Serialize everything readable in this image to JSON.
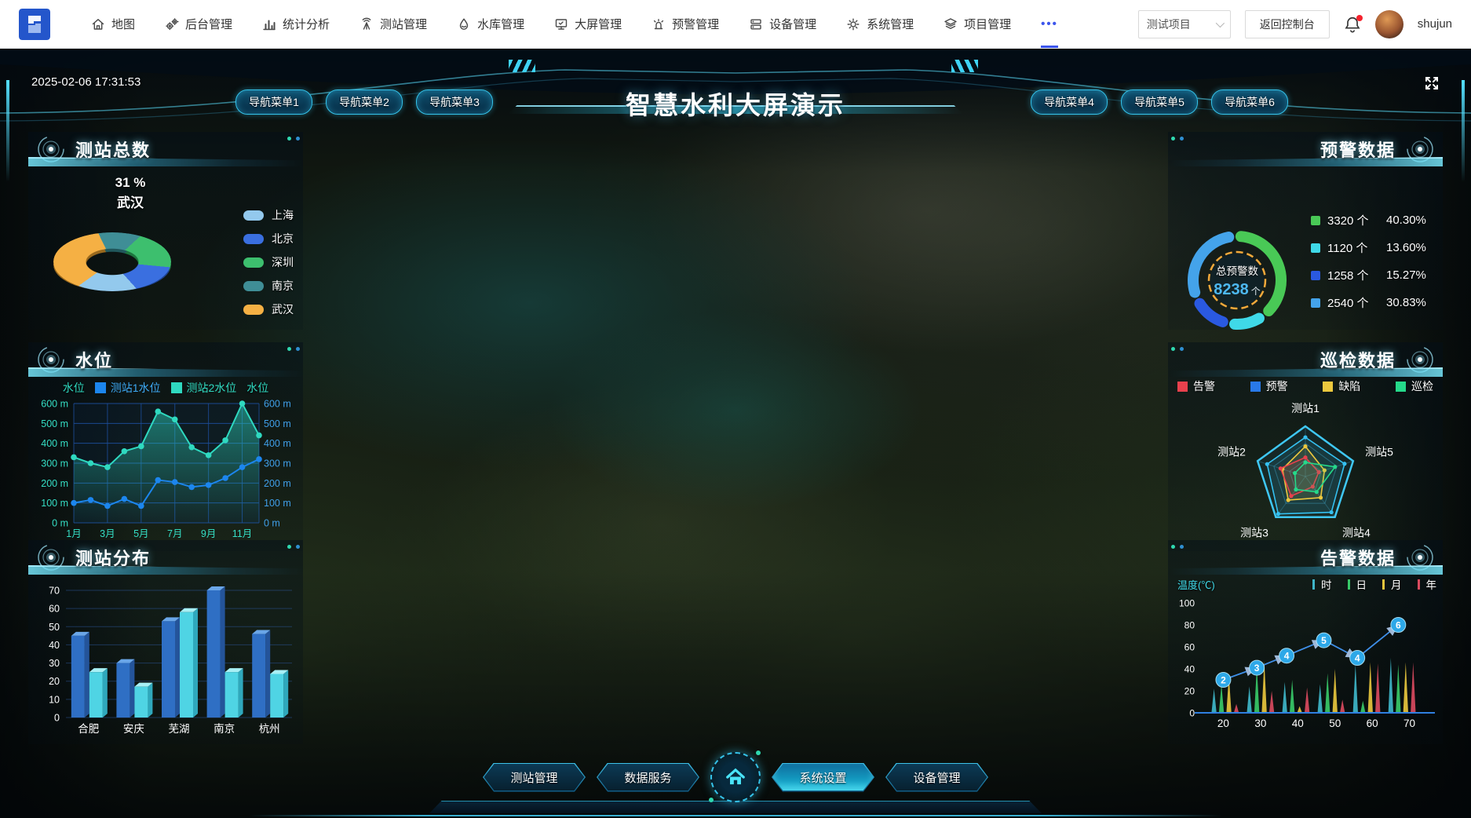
{
  "topnav": {
    "menu": [
      {
        "label": "地图"
      },
      {
        "label": "后台管理"
      },
      {
        "label": "统计分析"
      },
      {
        "label": "测站管理"
      },
      {
        "label": "水库管理"
      },
      {
        "label": "大屏管理"
      },
      {
        "label": "预警管理"
      },
      {
        "label": "设备管理"
      },
      {
        "label": "系统管理"
      },
      {
        "label": "项目管理"
      },
      {
        "label": "•••"
      }
    ],
    "project_select": "测试项目",
    "back_button": "返回控制台",
    "username": "shujun"
  },
  "screen": {
    "timestamp": "2025-02-06 17:31:53",
    "title": "智慧水利大屏演示",
    "nav_buttons_left": [
      "导航菜单1",
      "导航菜单2",
      "导航菜单3"
    ],
    "nav_buttons_right": [
      "导航菜单4",
      "导航菜单5",
      "导航菜单6"
    ],
    "bottom_nav": [
      "测站管理",
      "数据服务",
      "系统设置",
      "设备管理"
    ]
  },
  "panels": {
    "station_total_title": "测站总数",
    "water_level_title": "水位",
    "station_dist_title": "测站分布",
    "warning_title": "预警数据",
    "inspection_title": "巡检数据",
    "alarm_title": "告警数据"
  },
  "chart_data": [
    {
      "id": "station_pie",
      "type": "pie",
      "selected_label": "31 %",
      "selected_name": "武汉",
      "series": [
        {
          "name": "上海",
          "pct": 14,
          "color": "#93c9ed"
        },
        {
          "name": "北京",
          "pct": 13,
          "color": "#3a6fe0"
        },
        {
          "name": "深圳",
          "pct": 17,
          "color": "#3dbf6e"
        },
        {
          "name": "南京",
          "pct": 10,
          "color": "#3f8e96"
        },
        {
          "name": "武汉",
          "pct": 31,
          "color": "#f5b044"
        }
      ]
    },
    {
      "id": "water_line",
      "type": "line",
      "name": "水位",
      "axis_name": "水位",
      "categories": [
        "1月",
        "2月",
        "3月",
        "4月",
        "5月",
        "6月",
        "7月",
        "8月",
        "9月",
        "10月",
        "11月",
        "12月"
      ],
      "x_tick_labels": [
        "1月",
        "3月",
        "5月",
        "7月",
        "9月",
        "11月"
      ],
      "yticks": [
        "600 m",
        "500 m",
        "400 m",
        "300 m",
        "200 m",
        "100 m",
        "0 m"
      ],
      "ylim": [
        0,
        600
      ],
      "series": [
        {
          "name": "测站1水位",
          "color": "#1c86ee",
          "values": [
            100,
            115,
            85,
            120,
            85,
            215,
            205,
            180,
            190,
            225,
            280,
            320
          ]
        },
        {
          "name": "测站2水位",
          "color": "#2fd9c0",
          "area": true,
          "values": [
            330,
            300,
            280,
            360,
            385,
            560,
            520,
            380,
            340,
            415,
            600,
            440
          ]
        }
      ]
    },
    {
      "id": "dist_bar",
      "type": "bar",
      "categories": [
        "合肥",
        "安庆",
        "芜湖",
        "南京",
        "杭州"
      ],
      "yticks": [
        0,
        10,
        20,
        30,
        40,
        50,
        60,
        70
      ],
      "ylim": [
        0,
        70
      ],
      "series": [
        {
          "name": "测站数1",
          "color": "#2f6fc4",
          "top": "#6aa6e8",
          "side": "#24549a",
          "values": [
            45,
            30,
            53,
            70,
            46
          ]
        },
        {
          "name": "测站数2",
          "color": "#4fd4e4",
          "top": "#a8f0f5",
          "side": "#2fa8bc",
          "values": [
            25,
            17,
            58,
            25,
            24
          ]
        }
      ]
    },
    {
      "id": "warning_donut",
      "type": "pie",
      "center_title": "总预警数",
      "center_value": "8238",
      "center_unit": "个",
      "segments": [
        {
          "value": "3320 个",
          "pct": "40.30%",
          "num": 40.3,
          "color": "#49c956"
        },
        {
          "value": "1120 个",
          "pct": "13.60%",
          "num": 13.6,
          "color": "#3fd9e8"
        },
        {
          "value": "1258 个",
          "pct": "15.27%",
          "num": 15.27,
          "color": "#2a59e0"
        },
        {
          "value": "2540 个",
          "pct": "30.83%",
          "num": 30.83,
          "color": "#44a3ea"
        }
      ]
    },
    {
      "id": "inspect_radar",
      "type": "radar",
      "max": 100,
      "axes": [
        "测站1",
        "测站2",
        "测站3",
        "测站4",
        "测站5"
      ],
      "legend": [
        {
          "name": "告警",
          "color": "#e8414d"
        },
        {
          "name": "预警",
          "color": "#2979e8"
        },
        {
          "name": "缺陷",
          "color": "#ecc83e"
        },
        {
          "name": "巡检",
          "color": "#25d98a"
        }
      ],
      "series": [
        {
          "name": "预警",
          "color": "#35c0f0",
          "values": [
            78,
            80,
            92,
            88,
            82
          ]
        },
        {
          "name": "缺陷",
          "color": "#ecc83e",
          "values": [
            60,
            48,
            58,
            52,
            40
          ]
        },
        {
          "name": "告警",
          "color": "#e8414d",
          "values": [
            38,
            52,
            48,
            25,
            28
          ]
        },
        {
          "name": "巡检",
          "color": "#25d98a",
          "values": [
            28,
            22,
            32,
            38,
            62
          ]
        }
      ]
    },
    {
      "id": "alarm_spike",
      "type": "area",
      "ylabel": "温度(℃)",
      "yticks": [
        100,
        80,
        60,
        40,
        20,
        0
      ],
      "ylim": [
        0,
        100
      ],
      "xticks": [
        20,
        30,
        40,
        50,
        60,
        70
      ],
      "legend": [
        {
          "name": "时",
          "color": "#3fb6c9"
        },
        {
          "name": "日",
          "color": "#38c968"
        },
        {
          "name": "月",
          "color": "#e8c53d"
        },
        {
          "name": "年",
          "color": "#d94a5e"
        }
      ],
      "line": {
        "color": "#3f8fe8",
        "points": [
          {
            "x": 20,
            "y": 30,
            "label": "2"
          },
          {
            "x": 29,
            "y": 41,
            "label": "3"
          },
          {
            "x": 37,
            "y": 52,
            "label": "4"
          },
          {
            "x": 47,
            "y": 66,
            "label": "5"
          },
          {
            "x": 56,
            "y": 50,
            "label": "4"
          },
          {
            "x": 67,
            "y": 80,
            "label": "6"
          }
        ]
      },
      "spikes": [
        {
          "x": 17.5,
          "h": 22,
          "s": 0
        },
        {
          "x": 19.5,
          "h": 26,
          "s": 1
        },
        {
          "x": 21.5,
          "h": 34,
          "s": 2
        },
        {
          "x": 23.5,
          "h": 8,
          "s": 3
        },
        {
          "x": 27,
          "h": 24,
          "s": 0
        },
        {
          "x": 29,
          "h": 42,
          "s": 1
        },
        {
          "x": 31,
          "h": 47,
          "s": 2
        },
        {
          "x": 33,
          "h": 20,
          "s": 3
        },
        {
          "x": 36.5,
          "h": 28,
          "s": 0
        },
        {
          "x": 38.5,
          "h": 30,
          "s": 1
        },
        {
          "x": 40.5,
          "h": 6,
          "s": 2
        },
        {
          "x": 42.5,
          "h": 23,
          "s": 3
        },
        {
          "x": 46,
          "h": 26,
          "s": 0
        },
        {
          "x": 48,
          "h": 36,
          "s": 1
        },
        {
          "x": 50,
          "h": 40,
          "s": 2
        },
        {
          "x": 52,
          "h": 12,
          "s": 3
        },
        {
          "x": 55.5,
          "h": 44,
          "s": 0
        },
        {
          "x": 57.5,
          "h": 11,
          "s": 1
        },
        {
          "x": 59.5,
          "h": 46,
          "s": 2
        },
        {
          "x": 61.5,
          "h": 45,
          "s": 3
        },
        {
          "x": 65,
          "h": 50,
          "s": 0
        },
        {
          "x": 67,
          "h": 44,
          "s": 1
        },
        {
          "x": 69,
          "h": 46,
          "s": 2
        },
        {
          "x": 71,
          "h": 46,
          "s": 3
        }
      ]
    }
  ]
}
